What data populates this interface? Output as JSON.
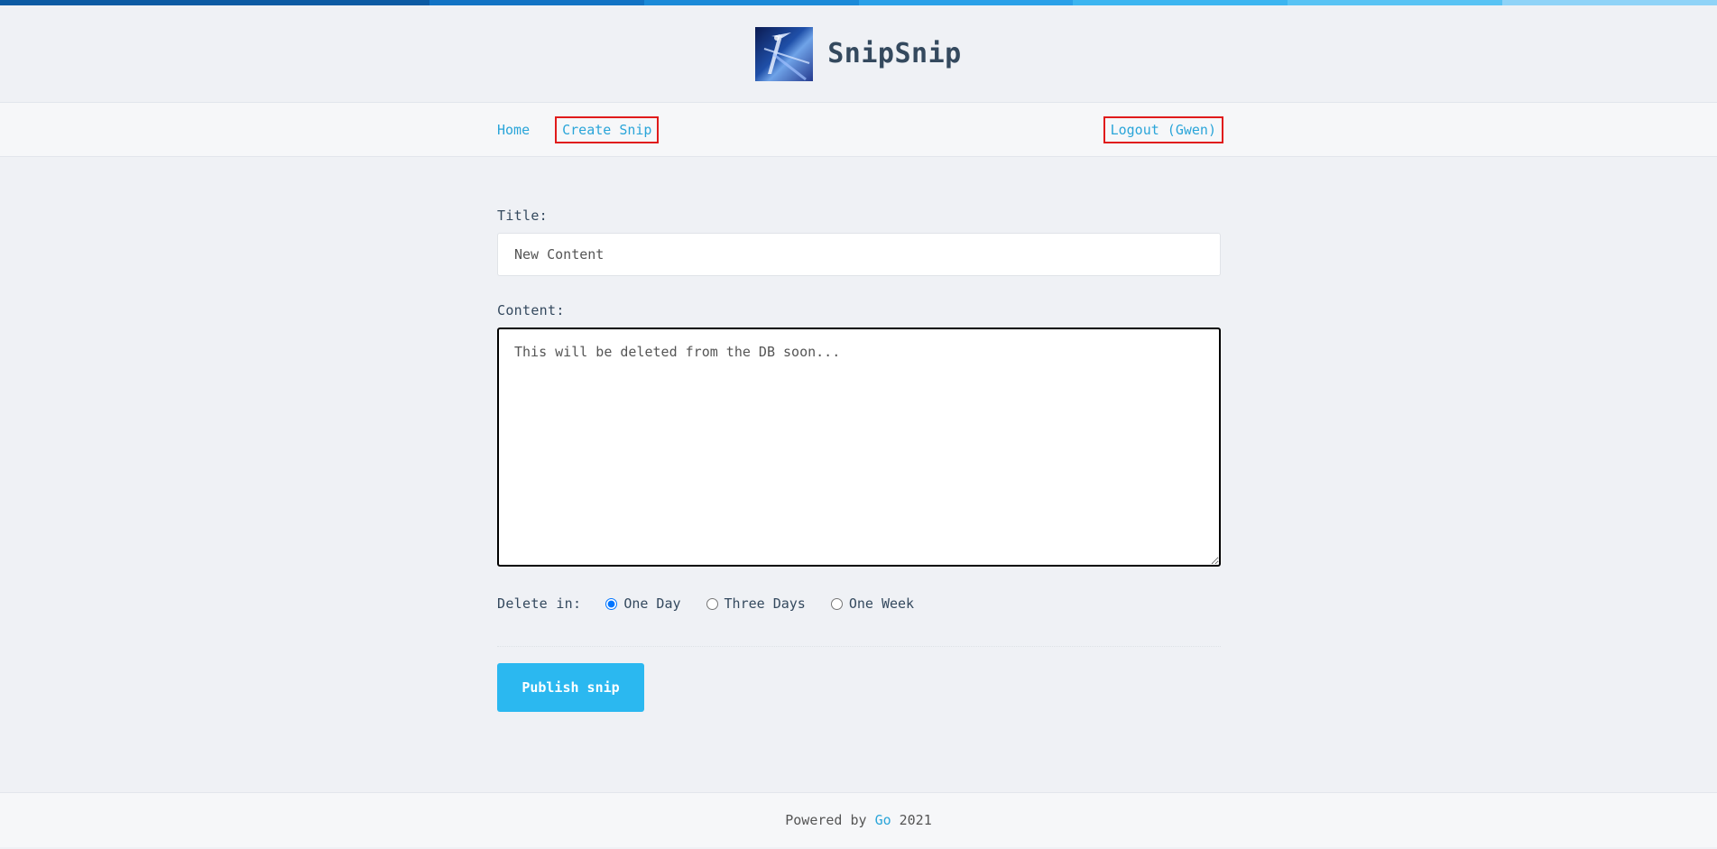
{
  "colors": {
    "topbar": [
      "#0c5ba3",
      "#0c5ba3",
      "#1273c4",
      "#1b8ad8",
      "#2aa0e8",
      "#3cb5f0",
      "#58c3f4",
      "#8fd3f7"
    ],
    "link": "#2aa5d9",
    "button": "#2bb8f0",
    "highlight_box": "#e01b1b"
  },
  "header": {
    "brand": "SnipSnip",
    "logo_icon": "logo-image"
  },
  "nav": {
    "home": "Home",
    "create": "Create Snip",
    "logout": "Logout (Gwen)"
  },
  "form": {
    "title_label": "Title:",
    "title_value": "New Content",
    "content_label": "Content:",
    "content_value": "This will be deleted from the DB soon...",
    "delete_label": "Delete in:",
    "options": [
      {
        "label": "One Day",
        "checked": true
      },
      {
        "label": "Three Days",
        "checked": false
      },
      {
        "label": "One Week",
        "checked": false
      }
    ],
    "submit": "Publish snip"
  },
  "footer": {
    "prefix": "Powered by",
    "link": "Go",
    "year": "2021"
  }
}
